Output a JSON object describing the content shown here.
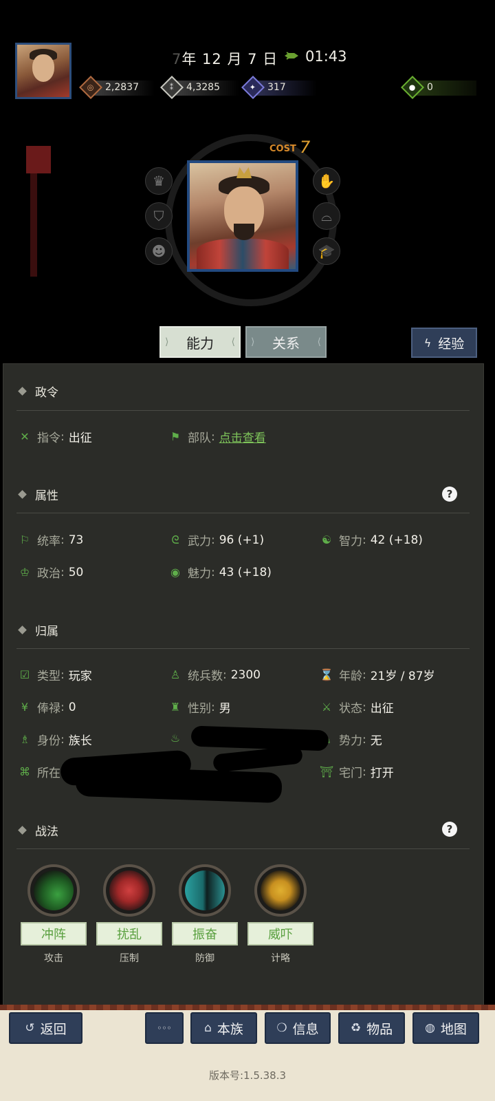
{
  "header": {
    "date": "年 12 月 7 日",
    "date_prefix": "7",
    "time": "01:43",
    "resources": [
      {
        "icon": "coin-icon",
        "value": "2,2837",
        "color": "#b06a40"
      },
      {
        "icon": "grain-icon",
        "value": "4,3285",
        "color": "#b8b8b0"
      },
      {
        "icon": "troop-icon",
        "value": "317",
        "color": "#6a6ac8"
      },
      {
        "icon": "gem-icon",
        "value": "0",
        "color": "#5aa030"
      }
    ]
  },
  "portrait": {
    "cost_label": "COST",
    "cost_value": "7"
  },
  "tabs": {
    "ability": "能力",
    "relation": "关系",
    "exp": "经验"
  },
  "sections": {
    "orders": {
      "title": "政令",
      "command_label": "指令",
      "command_value": "出征",
      "troop_label": "部队",
      "troop_value": "点击查看"
    },
    "attributes": {
      "title": "属性",
      "help": "?",
      "leadership_label": "统率",
      "leadership_value": "73",
      "force_label": "武力",
      "force_value": "96 (+1)",
      "intellect_label": "智力",
      "intellect_value": "42 (+18)",
      "politics_label": "政治",
      "politics_value": "50",
      "charm_label": "魅力",
      "charm_value": "43 (+18)"
    },
    "affiliation": {
      "title": "归属",
      "type_label": "类型",
      "type_value": "玩家",
      "troops_label": "统兵数",
      "troops_value": "2300",
      "age_label": "年龄",
      "age_value": "21岁 / 87岁",
      "salary_label": "俸禄",
      "salary_value": "0",
      "gender_label": "性别",
      "gender_value": "男",
      "status_label": "状态",
      "status_value": "出征",
      "identity_label": "身份",
      "identity_value": "族长",
      "faction_label": "势力",
      "faction_value": "无",
      "location_label": "所在",
      "gate_label": "宅门",
      "gate_value": "打开"
    },
    "tactics": {
      "title": "战法",
      "help": "?",
      "skills": [
        {
          "name": "冲阵",
          "type": "攻击",
          "color": "#3aa040"
        },
        {
          "name": "扰乱",
          "type": "压制",
          "color": "#b02a2a"
        },
        {
          "name": "振奋",
          "type": "防御",
          "color": "#2a9a9a"
        },
        {
          "name": "威吓",
          "type": "计略",
          "color": "#c8a020"
        }
      ]
    }
  },
  "nav": {
    "back": "返回",
    "more": "◦◦◦",
    "clan": "本族",
    "info": "信息",
    "items": "物品",
    "map": "地图"
  },
  "version": "版本号:1.5.38.3"
}
